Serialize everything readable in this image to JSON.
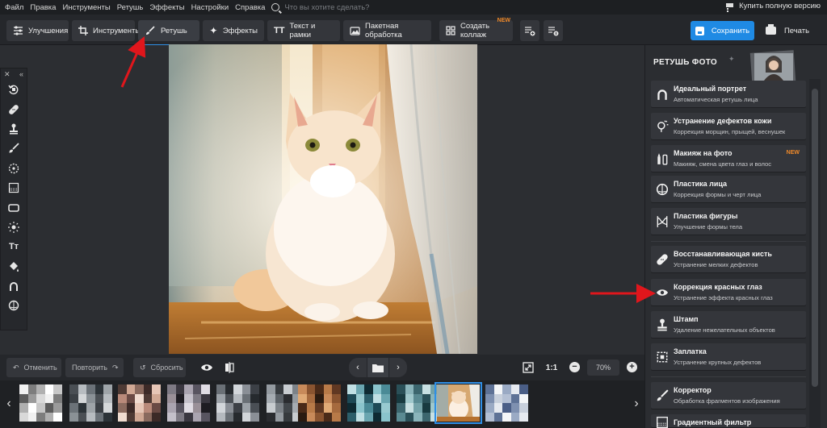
{
  "menu": {
    "items": [
      "Файл",
      "Правка",
      "Инструменты",
      "Ретушь",
      "Эффекты",
      "Настройки",
      "Справка"
    ],
    "search_placeholder": "Что вы хотите сделать?",
    "buy_full": "Купить полную версию"
  },
  "toolbar": {
    "tabs": [
      {
        "label": "Улучшения",
        "icon": "sliders-icon"
      },
      {
        "label": "Инструменты",
        "icon": "crop-icon"
      },
      {
        "label": "Ретушь",
        "icon": "brush-icon",
        "active": true
      },
      {
        "label": "Эффекты",
        "icon": "sparkle-icon"
      },
      {
        "label": "Текст и рамки",
        "icon": "text-icon"
      },
      {
        "label": "Пакетная обработка",
        "icon": "image-stack-icon"
      },
      {
        "label": "Создать коллаж",
        "icon": "collage-icon",
        "badge": "NEW"
      }
    ],
    "save_label": "Сохранить",
    "print_label": "Печать"
  },
  "left_tools": [
    "rotate-icon",
    "bandage-icon",
    "stamp-icon",
    "brush-icon",
    "dotted-circle-icon",
    "gradient-icon",
    "rounded-rect-icon",
    "sun-icon",
    "text-icon",
    "bucket-icon",
    "portrait-icon",
    "face-shape-icon"
  ],
  "bottom": {
    "undo": "Отменить",
    "redo": "Повторить",
    "reset": "Сбросить",
    "zoom_ratio": "1:1",
    "zoom_value": "70%"
  },
  "retouch_panel": {
    "title": "РЕТУШЬ ФОТО",
    "items": [
      {
        "title": "Идеальный портрет",
        "subtitle": "Автоматическая ретушь лица",
        "icon": "portrait-icon"
      },
      {
        "title": "Устранение дефектов кожи",
        "subtitle": "Коррекция морщин, прыщей, веснушек",
        "icon": "skin-icon"
      },
      {
        "title": "Макияж на фото",
        "subtitle": "Макияж, смена цвета глаз и волос",
        "icon": "makeup-icon",
        "badge": "NEW"
      },
      {
        "title": "Пластика лица",
        "subtitle": "Коррекция формы и черт лица",
        "icon": "face-shape-icon"
      },
      {
        "title": "Пластика фигуры",
        "subtitle": "Улучшение формы тела",
        "icon": "figure-icon"
      },
      {
        "title": "Восстанавливающая кисть",
        "subtitle": "Устранение мелких дефектов",
        "icon": "bandage-icon"
      },
      {
        "title": "Коррекция красных глаз",
        "subtitle": "Устранение эффекта красных глаз",
        "icon": "eye-icon"
      },
      {
        "title": "Штамп",
        "subtitle": "Удаление нежелательных объектов",
        "icon": "stamp-icon"
      },
      {
        "title": "Заплатка",
        "subtitle": "Устранение крупных дефектов",
        "icon": "patch-icon"
      },
      {
        "title": "Корректор",
        "subtitle": "Обработка фрагментов изображения",
        "icon": "brush-icon"
      },
      {
        "title": "Градиентный фильтр",
        "subtitle": "",
        "icon": "gradient-icon"
      }
    ]
  },
  "colors": {
    "accent": "#1f8ae4",
    "badge": "#f08a2a",
    "annotation_arrow": "#e0161c"
  }
}
